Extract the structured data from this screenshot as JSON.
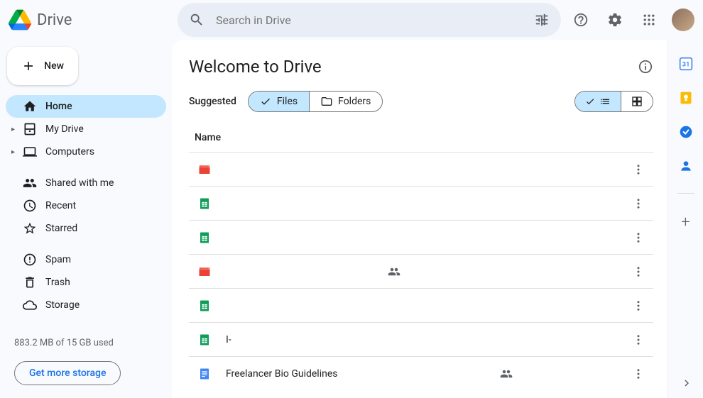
{
  "header": {
    "brand": "Drive",
    "search_placeholder": "Search in Drive"
  },
  "new_button_label": "New",
  "nav": {
    "home": "Home",
    "my_drive": "My Drive",
    "computers": "Computers",
    "shared": "Shared with me",
    "recent": "Recent",
    "starred": "Starred",
    "spam": "Spam",
    "trash": "Trash",
    "storage": "Storage"
  },
  "storage": {
    "used_text": "883.2 MB of 15 GB used",
    "cta": "Get more storage"
  },
  "main": {
    "title": "Welcome to Drive",
    "suggested_label": "Suggested",
    "chip_files": "Files",
    "chip_folders": "Folders",
    "col_name": "Name"
  },
  "files": [
    {
      "type": "video",
      "name": "",
      "shared": false
    },
    {
      "type": "sheets",
      "name": "",
      "shared": false
    },
    {
      "type": "sheets",
      "name": "",
      "shared": false
    },
    {
      "type": "video",
      "name": "",
      "shared": true
    },
    {
      "type": "sheets",
      "name": "",
      "shared": false
    },
    {
      "type": "sheets",
      "name": "I-",
      "shared": false
    },
    {
      "type": "docs",
      "name": "Freelancer Bio Guidelines",
      "shared": true
    }
  ],
  "sidepanel": {
    "apps": [
      "calendar",
      "keep",
      "tasks",
      "contacts"
    ]
  }
}
